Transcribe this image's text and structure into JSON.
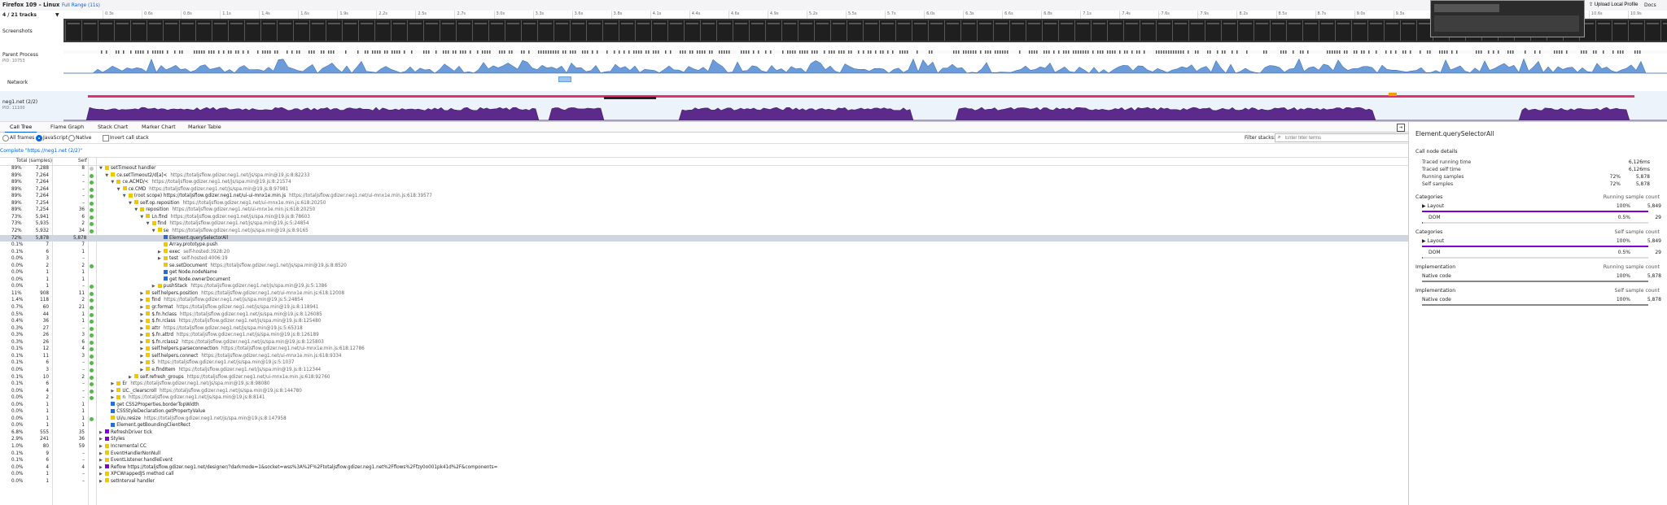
{
  "app": {
    "title": "Firefox 109 – Linux",
    "full_range": "Full Range (11s)",
    "upload": "Upload Local Profile",
    "docs": "Docs",
    "tracks": "4 / 21 tracks"
  },
  "timeline": {
    "ticks": [
      "0.3s",
      "0.6s",
      "0.8s",
      "1.1s",
      "1.4s",
      "1.6s",
      "1.9s",
      "2.2s",
      "2.5s",
      "2.7s",
      "3.0s",
      "3.3s",
      "3.6s",
      "3.8s",
      "4.1s",
      "4.4s",
      "4.6s",
      "4.9s",
      "5.2s",
      "5.5s",
      "5.7s",
      "6.0s",
      "6.3s",
      "6.6s",
      "6.8s",
      "7.1s",
      "7.4s",
      "7.6s",
      "7.9s",
      "8.2s",
      "8.5s",
      "8.7s",
      "9.0s",
      "9.3s",
      "9.6s",
      "9.8s",
      "10s",
      "10.4s",
      "10.6s",
      "10.9s"
    ],
    "screenshots": "Screenshots",
    "parent": {
      "name": "Parent Process",
      "pid": "PID: 10753"
    },
    "network": "Network",
    "neg": {
      "name": "neg1.net (2/2)",
      "pid": "PID: 11100"
    }
  },
  "tabs": [
    "Call Tree",
    "Flame Graph",
    "Stack Chart",
    "Marker Chart",
    "Marker Table"
  ],
  "settings": {
    "all_frames": "All frames",
    "javascript": "JavaScript",
    "native": "Native",
    "invert": "Invert call stack",
    "filter_label": "Filter stacks:",
    "filter_placeholder": "Enter filter terms"
  },
  "breadcrumb": "Complete \"https://neg1.net (2/2)\"",
  "tree_header": {
    "total": "Total (samples)",
    "self": "Self"
  },
  "tree_rows": [
    {
      "pct": "89%",
      "total": "7,288",
      "self": "8",
      "depth": 0,
      "tw": "▼",
      "cat": "#f0c800",
      "fn": "setTimeout handler",
      "loc": "",
      "ind": "#c6c6c6"
    },
    {
      "pct": "89%",
      "total": "7,264",
      "self": "–",
      "depth": 1,
      "tw": "▼",
      "cat": "#f0c800",
      "fn": "ce.setTimeout2/d[a]<",
      "loc": "https://totaljsflow.gdizer.neg1.net/js/spa.min@19.js:8:82233",
      "ind": "#54b948"
    },
    {
      "pct": "89%",
      "total": "7,264",
      "self": "–",
      "depth": 2,
      "tw": "▼",
      "cat": "#f0c800",
      "fn": "ce.ACMD/<",
      "loc": "https://totaljsflow.gdizer.neg1.net/js/spa.min@19.js:8:21574",
      "ind": "#54b948"
    },
    {
      "pct": "89%",
      "total": "7,264",
      "self": "–",
      "depth": 3,
      "tw": "▼",
      "cat": "#f0c800",
      "fn": "ce.CMD",
      "loc": "https://totaljsflow.gdizer.neg1.net/js/spa.min@19.js:8:97981",
      "ind": "#54b948"
    },
    {
      "pct": "89%",
      "total": "7,264",
      "self": "–",
      "depth": 4,
      "tw": "▼",
      "cat": "#f0c800",
      "fn": "(root scope) https://totaljsflow.gdizer.neg1.net/ui-ui-mnx1e.min.js",
      "loc": "https://totaljsflow.gdizer.neg1.net/ui-mnx1e.min.js:618:39577",
      "ind": "#54b948"
    },
    {
      "pct": "89%",
      "total": "7,254",
      "self": "–",
      "depth": 5,
      "tw": "▼",
      "cat": "#f0c800",
      "fn": "self.op.reposition",
      "loc": "https://totaljsflow.gdizer.neg1.net/ui-mnx1e.min.js:618:20250",
      "ind": "#54b948"
    },
    {
      "pct": "89%",
      "total": "7,254",
      "self": "36",
      "depth": 6,
      "tw": "▼",
      "cat": "#f0c800",
      "fn": "reposition",
      "loc": "https://totaljsflow.gdizer.neg1.net/ui-mnx1e.min.js:618:20250",
      "ind": "#54b948"
    },
    {
      "pct": "73%",
      "total": "5,941",
      "self": "6",
      "depth": 7,
      "tw": "▼",
      "cat": "#f0c800",
      "fn": "Ln.find",
      "loc": "https://totaljsflow.gdizer.neg1.net/js/spa.min@19.js:8:78603",
      "ind": "#54b948"
    },
    {
      "pct": "73%",
      "total": "5,935",
      "self": "2",
      "depth": 8,
      "tw": "▼",
      "cat": "#f0c800",
      "fn": "find",
      "loc": "https://totaljsflow.gdizer.neg1.net/js/spa.min@19.js:5:24854",
      "ind": "#54b948"
    },
    {
      "pct": "72%",
      "total": "5,932",
      "self": "34",
      "depth": 9,
      "tw": "▼",
      "cat": "#f0c800",
      "fn": "se",
      "loc": "https://totaljsflow.gdizer.neg1.net/js/spa.min@19.js:8:9165",
      "ind": "#54b948"
    },
    {
      "pct": "72%",
      "total": "5,878",
      "self": "5,878",
      "depth": 10,
      "tw": "",
      "cat": "#2b6cd4",
      "fn": "Element.querySelectorAll",
      "loc": "",
      "ind": "",
      "sel": true
    },
    {
      "pct": "0.1%",
      "total": "7",
      "self": "7",
      "depth": 10,
      "tw": "",
      "cat": "#f0c800",
      "fn": "Array.prototype.push",
      "loc": "",
      "ind": ""
    },
    {
      "pct": "0.1%",
      "total": "6",
      "self": "1",
      "depth": 10,
      "tw": "▶",
      "cat": "#f0c800",
      "fn": "exec",
      "loc": "self-hosted:3928:20",
      "ind": ""
    },
    {
      "pct": "0.0%",
      "total": "3",
      "self": "–",
      "depth": 10,
      "tw": "▶",
      "cat": "#f0c800",
      "fn": "test",
      "loc": "self-hosted:4006:19",
      "ind": ""
    },
    {
      "pct": "0.0%",
      "total": "2",
      "self": "2",
      "depth": 10,
      "tw": "",
      "cat": "#f0c800",
      "fn": "se.setDocument",
      "loc": "https://totaljsflow.gdizer.neg1.net/js/spa.min@19.js:8:8520",
      "ind": "#54b948"
    },
    {
      "pct": "0.0%",
      "total": "1",
      "self": "1",
      "depth": 10,
      "tw": "",
      "cat": "#2b6cd4",
      "fn": "get Node.nodeName",
      "loc": "",
      "ind": ""
    },
    {
      "pct": "0.0%",
      "total": "1",
      "self": "1",
      "depth": 10,
      "tw": "",
      "cat": "#2b6cd4",
      "fn": "get Node.ownerDocument",
      "loc": "",
      "ind": ""
    },
    {
      "pct": "0.0%",
      "total": "1",
      "self": "–",
      "depth": 9,
      "tw": "▶",
      "cat": "#f0c800",
      "fn": "pushStack",
      "loc": "https://totaljsflow.gdizer.neg1.net/js/spa.min@19.js:5:1386",
      "ind": "#54b948"
    },
    {
      "pct": "11%",
      "total": "908",
      "self": "11",
      "depth": 7,
      "tw": "▶",
      "cat": "#f0c800",
      "fn": "self.helpers.position",
      "loc": "https://totaljsflow.gdizer.neg1.net/ui-mnx1e.min.js:618:12008",
      "ind": "#54b948"
    },
    {
      "pct": "1.4%",
      "total": "118",
      "self": "2",
      "depth": 7,
      "tw": "▶",
      "cat": "#f0c800",
      "fn": "find",
      "loc": "https://totaljsflow.gdizer.neg1.net/js/spa.min@19.js:5:24854",
      "ind": "#54b948"
    },
    {
      "pct": "0.7%",
      "total": "60",
      "self": "21",
      "depth": 7,
      "tw": "▶",
      "cat": "#f0c800",
      "fn": "gr.format",
      "loc": "https://totaljsflow.gdizer.neg1.net/js/spa.min@19.js:8:118941",
      "ind": "#54b948"
    },
    {
      "pct": "0.5%",
      "total": "44",
      "self": "1",
      "depth": 7,
      "tw": "▶",
      "cat": "#f0c800",
      "fn": "$.fn.hclass",
      "loc": "https://totaljsflow.gdizer.neg1.net/js/spa.min@19.js:8:126085",
      "ind": "#54b948"
    },
    {
      "pct": "0.4%",
      "total": "36",
      "self": "1",
      "depth": 7,
      "tw": "▶",
      "cat": "#f0c800",
      "fn": "$.fn.rclass",
      "loc": "https://totaljsflow.gdizer.neg1.net/js/spa.min@19.js:8:125480",
      "ind": "#54b948"
    },
    {
      "pct": "0.3%",
      "total": "27",
      "self": "–",
      "depth": 7,
      "tw": "▶",
      "cat": "#f0c800",
      "fn": "attr",
      "loc": "https://totaljsflow.gdizer.neg1.net/js/spa.min@19.js:5:65318",
      "ind": "#54b948"
    },
    {
      "pct": "0.3%",
      "total": "26",
      "self": "3",
      "depth": 7,
      "tw": "▶",
      "cat": "#f0c800",
      "fn": "$.fn.attrd",
      "loc": "https://totaljsflow.gdizer.neg1.net/js/spa.min@19.js:8:126189",
      "ind": "#54b948"
    },
    {
      "pct": "0.3%",
      "total": "26",
      "self": "6",
      "depth": 7,
      "tw": "▶",
      "cat": "#f0c800",
      "fn": "$.fn.rclass2",
      "loc": "https://totaljsflow.gdizer.neg1.net/js/spa.min@19.js:8:125803",
      "ind": "#54b948"
    },
    {
      "pct": "0.1%",
      "total": "12",
      "self": "4",
      "depth": 7,
      "tw": "▶",
      "cat": "#f0c800",
      "fn": "self.helpers.parseconnection",
      "loc": "https://totaljsflow.gdizer.neg1.net/ui-mnx1e.min.js:618:12786",
      "ind": "#54b948"
    },
    {
      "pct": "0.1%",
      "total": "11",
      "self": "3",
      "depth": 7,
      "tw": "▶",
      "cat": "#f0c800",
      "fn": "self.helpers.connect",
      "loc": "https://totaljsflow.gdizer.neg1.net/ui-mnx1e.min.js:618:9334",
      "ind": "#54b948"
    },
    {
      "pct": "0.1%",
      "total": "6",
      "self": "–",
      "depth": 7,
      "tw": "▶",
      "cat": "#f0c800",
      "fn": "S",
      "loc": "https://totaljsflow.gdizer.neg1.net/js/spa.min@19.js:5:1037",
      "ind": "#54b948"
    },
    {
      "pct": "0.0%",
      "total": "3",
      "self": "–",
      "depth": 7,
      "tw": "▶",
      "cat": "#f0c800",
      "fn": "e.findItem",
      "loc": "https://totaljsflow.gdizer.neg1.net/js/spa.min@19.js:8:112344",
      "ind": "#54b948"
    },
    {
      "pct": "0.1%",
      "total": "10",
      "self": "2",
      "depth": 5,
      "tw": "▶",
      "cat": "#f0c800",
      "fn": "self.refresh_groups",
      "loc": "https://totaljsflow.gdizer.neg1.net/ui-mnx1e.min.js:618:92760",
      "ind": "#54b948"
    },
    {
      "pct": "0.1%",
      "total": "6",
      "self": "–",
      "depth": 2,
      "tw": "▶",
      "cat": "#f0c800",
      "fn": "Er",
      "loc": "https://totaljsflow.gdizer.neg1.net/js/spa.min@19.js:8:98080",
      "ind": "#54b948"
    },
    {
      "pct": "0.0%",
      "total": "4",
      "self": "–",
      "depth": 2,
      "tw": "▶",
      "cat": "#f0c800",
      "fn": "UC._clearscroll",
      "loc": "https://totaljsflow.gdizer.neg1.net/js/spa.min@19.js:8:144780",
      "ind": "#54b948"
    },
    {
      "pct": "0.0%",
      "total": "2",
      "self": "–",
      "depth": 2,
      "tw": "▶",
      "cat": "#f0c800",
      "fn": "n",
      "loc": "https://totaljsflow.gdizer.neg1.net/js/spa.min@19.js:8:8141",
      "ind": "#54b948"
    },
    {
      "pct": "0.0%",
      "total": "1",
      "self": "1",
      "depth": 1,
      "tw": "",
      "cat": "#2b6cd4",
      "fn": "get CSS2Properties.borderTopWidth",
      "loc": "",
      "ind": ""
    },
    {
      "pct": "0.0%",
      "total": "1",
      "self": "1",
      "depth": 1,
      "tw": "",
      "cat": "#2b6cd4",
      "fn": "CSSStyleDeclaration.getPropertyValue",
      "loc": "",
      "ind": ""
    },
    {
      "pct": "0.0%",
      "total": "1",
      "self": "1",
      "depth": 1,
      "tw": "",
      "cat": "#f0c800",
      "fn": "Ui/u.resize",
      "loc": "https://totaljsflow.gdizer.neg1.net/js/spa.min@19.js:8:147958",
      "ind": "#54b948"
    },
    {
      "pct": "0.0%",
      "total": "1",
      "self": "1",
      "depth": 1,
      "tw": "",
      "cat": "#2b6cd4",
      "fn": "Element.getBoundingClientRect",
      "loc": "",
      "ind": ""
    },
    {
      "pct": "6.8%",
      "total": "555",
      "self": "35",
      "depth": 0,
      "tw": "▶",
      "cat": "#8000d7",
      "fn": "RefreshDriver tick",
      "loc": "",
      "ind": ""
    },
    {
      "pct": "2.9%",
      "total": "241",
      "self": "36",
      "depth": 0,
      "tw": "▶",
      "cat": "#8000d7",
      "fn": "Styles",
      "loc": "",
      "ind": ""
    },
    {
      "pct": "1.0%",
      "total": "80",
      "self": "59",
      "depth": 0,
      "tw": "▶",
      "cat": "#f0c800",
      "fn": "Incremental CC",
      "loc": "",
      "ind": ""
    },
    {
      "pct": "0.1%",
      "total": "9",
      "self": "–",
      "depth": 0,
      "tw": "▶",
      "cat": "#f0c800",
      "fn": "EventHandlerNonNull",
      "loc": "",
      "ind": ""
    },
    {
      "pct": "0.1%",
      "total": "6",
      "self": "–",
      "depth": 0,
      "tw": "▶",
      "cat": "#f0c800",
      "fn": "EventListener.handleEvent",
      "loc": "",
      "ind": ""
    },
    {
      "pct": "0.0%",
      "total": "4",
      "self": "4",
      "depth": 0,
      "tw": "▶",
      "cat": "#8000d7",
      "fn": "Reflow https://totaljsflow.gdizer.neg1.net/designer/?darkmode=1&socket=wss%3A%2F%2Ftotaljsflow.gdizer.neg1.net%2Fflows%2Ffzy0o001pk41d%2F&components=",
      "loc": "",
      "ind": ""
    },
    {
      "pct": "0.0%",
      "total": "1",
      "self": "–",
      "depth": 0,
      "tw": "▶",
      "cat": "#f0c800",
      "fn": "XPCWrappedJS method call",
      "loc": "",
      "ind": ""
    },
    {
      "pct": "0.0%",
      "total": "1",
      "self": "–",
      "depth": 0,
      "tw": "▶",
      "cat": "#f0c800",
      "fn": "setInterval handler",
      "loc": "",
      "ind": ""
    }
  ],
  "sidebar": {
    "title": "Element.querySelectorAll",
    "details_heading": "Call node details",
    "details": [
      {
        "k": "Traced running time",
        "v": "6,126ms"
      },
      {
        "k": "Traced self time",
        "v": "6,126ms"
      },
      {
        "k": "Running samples",
        "v": "72%",
        "v2": "5,878"
      },
      {
        "k": "Self samples",
        "v": "72%",
        "v2": "5,878"
      }
    ],
    "categories_heading": "Categories",
    "running_sample_count": "Running sample count",
    "self_sample_count": "Self sample count",
    "categories_running": [
      {
        "name": "Layout",
        "pct": "100%",
        "count": "5,849",
        "fill": 1.0,
        "color": "#8000d7"
      },
      {
        "name": "DOM",
        "pct": "0.5%",
        "count": "29",
        "fill": 0.005,
        "color": "#2b6cd4"
      }
    ],
    "categories_self": [
      {
        "name": "Layout",
        "pct": "100%",
        "count": "5,849",
        "fill": 1.0,
        "color": "#8000d7"
      },
      {
        "name": "DOM",
        "pct": "0.5%",
        "count": "29",
        "fill": 0.005,
        "color": "#2b6cd4"
      }
    ],
    "implementation_heading": "Implementation",
    "impl_running": {
      "name": "Native code",
      "pct": "100%",
      "count": "5,878"
    },
    "impl_self": {
      "name": "Native code",
      "pct": "100%",
      "count": "5,878"
    }
  }
}
